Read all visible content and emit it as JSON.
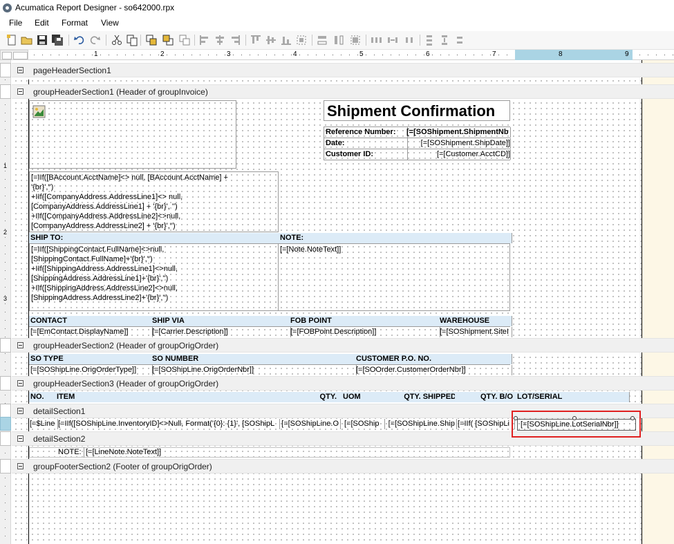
{
  "window": {
    "title": "Acumatica Report Designer - so642000.rpx"
  },
  "menu": [
    "File",
    "Edit",
    "Format",
    "View"
  ],
  "ruler": [
    "1",
    "2",
    "3",
    "4",
    "5",
    "6",
    "7",
    "8",
    "9"
  ],
  "gutter": [
    "1",
    "2",
    "3"
  ],
  "sections": {
    "page_header": "pageHeaderSection1",
    "group_header_1": "groupHeaderSection1 (Header of groupInvoice)",
    "group_header_2": "groupHeaderSection2 (Header of groupOrigOrder)",
    "group_header_3": "groupHeaderSection3 (Header of groupOrigOrder)",
    "detail_1": "detailSection1",
    "detail_2": "detailSection2",
    "group_footer_2": "groupFooterSection2 (Footer of groupOrigOrder)"
  },
  "header": {
    "title": "Shipment Confirmation",
    "ref_label": "Reference Number:",
    "ref_value": "[=[SOShipment.ShipmentNb",
    "date_label": "Date:",
    "date_value": "[=[SOShipment.ShipDate]]",
    "cust_label": "Customer ID:",
    "cust_value": "[=[Customer.AcctCD]]"
  },
  "company_expr": [
    "[=IIf([BAccount.AcctName]<> null, [BAccount.AcctName] +",
    "'{br}','')",
    "+IIf([CompanyAddress.AddressLine1]<> null,",
    "[CompanyAddress.AddressLine1] + '{br}', '')",
    "+IIf([CompanyAddress.AddressLine2]<>null,",
    "[CompanyAddress.AddressLine2] + '{br}','')"
  ],
  "ship_to": {
    "label": "SHIP TO:",
    "expr": [
      "[=IIf([ShippingContact.FullName]<>null,",
      "[ShippingContact.FullName]+'{br}','')",
      "+IIf([ShippingAddress.AddressLine1]<>null,",
      "[ShippingAddress.AddressLine1]+'{br}','')",
      "+IIf([ShippingAddress.AddressLine2]<>null,",
      "[ShippingAddress.AddressLine2]+'{br}','')"
    ]
  },
  "note": {
    "label": "NOTE:",
    "value": "[=[Note.NoteText]]"
  },
  "contact_row": {
    "headers": [
      "CONTACT",
      "SHIP VIA",
      "FOB POINT",
      "WAREHOUSE"
    ],
    "values": [
      "[=[EmContact.DisplayName]]",
      "[=[Carrier.Description]]",
      "[=[FOBPoint.Description]]",
      "[=[SOShipment.SiteI"
    ]
  },
  "order_row": {
    "headers": [
      "SO TYPE",
      "SO NUMBER",
      "CUSTOMER P.O. NO."
    ],
    "values": [
      "[=[SOShipLine.OrigOrderType]]",
      "[=[SOShipLine.OrigOrderNbr]]",
      "[=[SOOrder.CustomerOrderNbr]]"
    ]
  },
  "line_headers": [
    "NO.",
    "ITEM",
    "QTY.",
    "UOM",
    "QTY. SHIPPED",
    "QTY. B/O",
    "LOT/SERIAL"
  ],
  "detail_fields": [
    "[=$Line",
    "[=IIf([SOShipLine.InventoryID]<>Null, Format('{0}: {1}', [SOShipL",
    "[=[SOShipLine.O",
    "[=[SOShip",
    "[=[SOShipLine.Ship",
    "[=IIf( [SOShipLi",
    "[=[SOShipLine.LotSerialNbr]]"
  ],
  "line_note": {
    "label": "NOTE:",
    "value": "[=[LineNote.NoteText]]"
  },
  "colors": {
    "header_fill": "#dcebf7",
    "selection": "#e02020",
    "ruler_highlight": "#aad4e4"
  }
}
